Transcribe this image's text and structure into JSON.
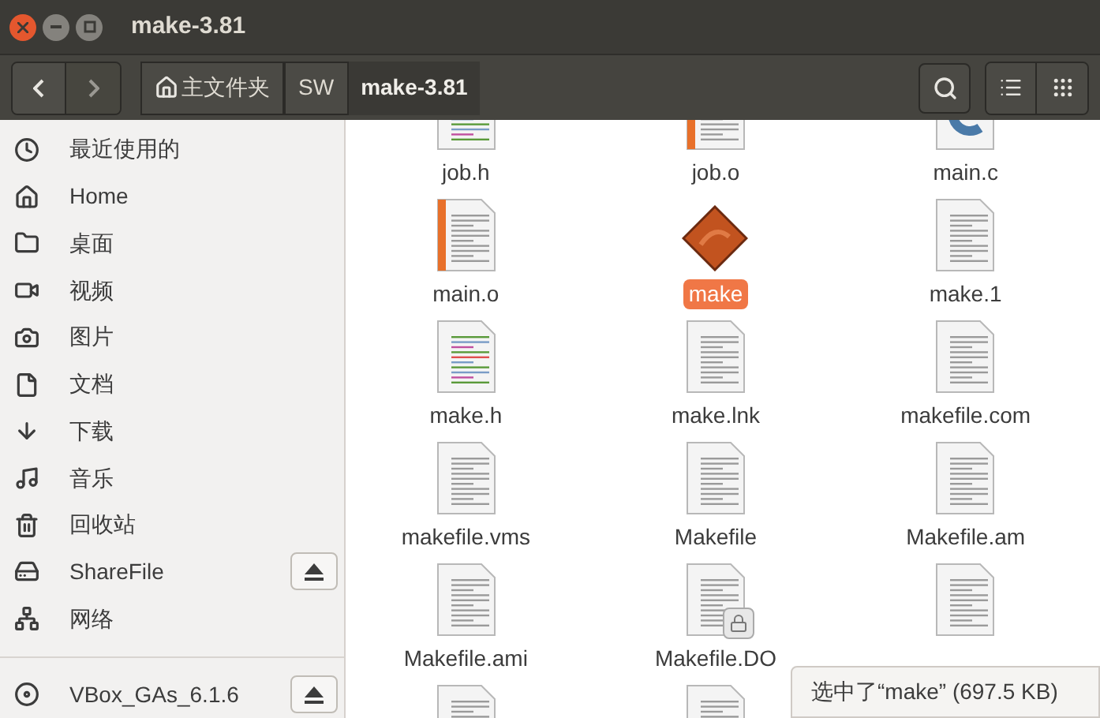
{
  "window": {
    "title": "make-3.81"
  },
  "breadcrumbs": [
    {
      "label": "主文件夹",
      "kind": "home",
      "selected": false
    },
    {
      "label": "SW",
      "kind": "plain",
      "selected": false
    },
    {
      "label": "make-3.81",
      "kind": "plain",
      "selected": true
    }
  ],
  "sidebar": {
    "items": [
      {
        "label": "最近使用的",
        "kind": "recent",
        "eject": false
      },
      {
        "label": "Home",
        "kind": "home",
        "eject": false
      },
      {
        "label": "桌面",
        "kind": "folder",
        "eject": false
      },
      {
        "label": "视频",
        "kind": "video",
        "eject": false
      },
      {
        "label": "图片",
        "kind": "camera",
        "eject": false
      },
      {
        "label": "文档",
        "kind": "document",
        "eject": false
      },
      {
        "label": "下载",
        "kind": "download",
        "eject": false
      },
      {
        "label": "音乐",
        "kind": "music",
        "eject": false
      },
      {
        "label": "回收站",
        "kind": "trash",
        "eject": false
      },
      {
        "label": "ShareFile",
        "kind": "drive",
        "eject": true
      },
      {
        "label": "网络",
        "kind": "network",
        "eject": false
      }
    ],
    "devices": [
      {
        "label": "VBox_GAs_6.1.6",
        "kind": "disc",
        "eject": true
      }
    ]
  },
  "files": [
    {
      "name": "job.h",
      "kind": "source",
      "selected": false,
      "locked": false
    },
    {
      "name": "job.o",
      "kind": "object",
      "selected": false,
      "locked": false
    },
    {
      "name": "main.c",
      "kind": "c",
      "selected": false,
      "locked": false
    },
    {
      "name": "main.o",
      "kind": "object",
      "selected": false,
      "locked": false
    },
    {
      "name": "make",
      "kind": "program",
      "selected": true,
      "locked": false
    },
    {
      "name": "make.1",
      "kind": "text",
      "selected": false,
      "locked": false
    },
    {
      "name": "make.h",
      "kind": "source",
      "selected": false,
      "locked": false
    },
    {
      "name": "make.lnk",
      "kind": "text",
      "selected": false,
      "locked": false
    },
    {
      "name": "makefile.com",
      "kind": "text",
      "selected": false,
      "locked": false
    },
    {
      "name": "makefile.vms",
      "kind": "text",
      "selected": false,
      "locked": false
    },
    {
      "name": "Makefile",
      "kind": "text",
      "selected": false,
      "locked": false
    },
    {
      "name": "Makefile.am",
      "kind": "text",
      "selected": false,
      "locked": false
    },
    {
      "name": "Makefile.ami",
      "kind": "text",
      "selected": false,
      "locked": false
    },
    {
      "name": "Makefile.DO",
      "kind": "text",
      "selected": false,
      "locked": true
    },
    {
      "kind": "text"
    },
    {
      "kind": "text"
    },
    {
      "kind": "text"
    }
  ],
  "status_bar": {
    "text": "选中了“make” (697.5 KB)"
  }
}
